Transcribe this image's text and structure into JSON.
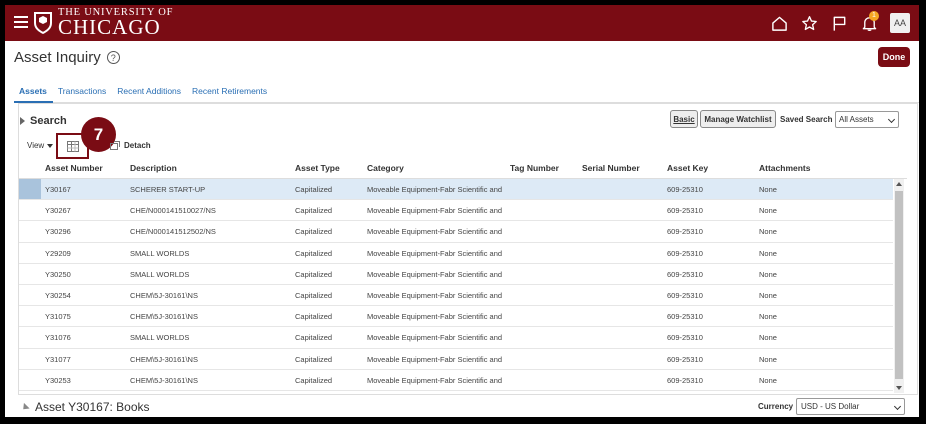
{
  "header": {
    "logo_line1": "THE UNIVERSITY OF",
    "logo_line2": "CHICAGO",
    "notification_count": "1",
    "avatar_initials": "AA",
    "icons": [
      "hamburger-menu-icon",
      "home-icon",
      "star-icon",
      "flag-icon",
      "bell-icon"
    ]
  },
  "page": {
    "title": "Asset Inquiry",
    "help_glyph": "?",
    "done_label": "Done"
  },
  "tabs": [
    {
      "label": "Assets",
      "active": true
    },
    {
      "label": "Transactions",
      "active": false
    },
    {
      "label": "Recent Additions",
      "active": false
    },
    {
      "label": "Recent Retirements",
      "active": false
    }
  ],
  "search": {
    "toggle_label": "Search",
    "basic_label": "Basic",
    "watchlist_label": "Manage Watchlist",
    "saved_search_label": "Saved Search",
    "saved_search_value": "All Assets"
  },
  "toolbar": {
    "view_label": "View",
    "detach_label": "Detach",
    "step_number": "7"
  },
  "table": {
    "columns": [
      "Asset Number",
      "Description",
      "Asset Type",
      "Category",
      "Tag Number",
      "Serial Number",
      "Asset Key",
      "Attachments"
    ],
    "rows": [
      [
        "Y30167",
        "SCHERER START-UP",
        "Capitalized",
        "Moveable Equipment-Fabr Scientific and",
        "",
        "",
        "609-25310",
        "None"
      ],
      [
        "Y30267",
        "CHE/N000141510027/NS",
        "Capitalized",
        "Moveable Equipment-Fabr Scientific and",
        "",
        "",
        "609-25310",
        "None"
      ],
      [
        "Y30296",
        "CHE/N000141512502/NS",
        "Capitalized",
        "Moveable Equipment-Fabr Scientific and",
        "",
        "",
        "609-25310",
        "None"
      ],
      [
        "Y29209",
        "SMALL WORLDS",
        "Capitalized",
        "Moveable Equipment-Fabr Scientific and",
        "",
        "",
        "609-25310",
        "None"
      ],
      [
        "Y30250",
        "SMALL WORLDS",
        "Capitalized",
        "Moveable Equipment-Fabr Scientific and",
        "",
        "",
        "609-25310",
        "None"
      ],
      [
        "Y30254",
        "CHEM\\5J-30161\\NS",
        "Capitalized",
        "Moveable Equipment-Fabr Scientific and",
        "",
        "",
        "609-25310",
        "None"
      ],
      [
        "Y31075",
        "CHEM\\5J-30161\\NS",
        "Capitalized",
        "Moveable Equipment-Fabr Scientific and",
        "",
        "",
        "609-25310",
        "None"
      ],
      [
        "Y31076",
        "SMALL WORLDS",
        "Capitalized",
        "Moveable Equipment-Fabr Scientific and",
        "",
        "",
        "609-25310",
        "None"
      ],
      [
        "Y31077",
        "CHEM\\5J-30161\\NS",
        "Capitalized",
        "Moveable Equipment-Fabr Scientific and",
        "",
        "",
        "609-25310",
        "None"
      ],
      [
        "Y30253",
        "CHEM\\5J-30161\\NS",
        "Capitalized",
        "Moveable Equipment-Fabr Scientific and",
        "",
        "",
        "609-25310",
        "None"
      ]
    ],
    "selected_row": 0
  },
  "bottom": {
    "section_title": "Asset Y30167: Books",
    "currency_label": "Currency",
    "currency_value": "USD - US Dollar"
  },
  "colors": {
    "brand": "#7a0c14",
    "link": "#2a6fb4",
    "selected_row": "#ddeaf6"
  }
}
